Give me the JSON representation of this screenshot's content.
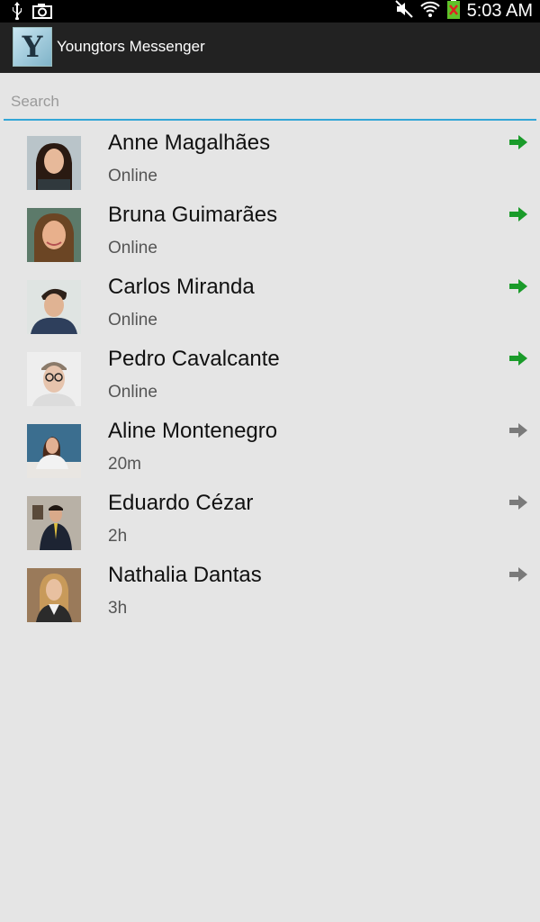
{
  "status_bar": {
    "time": "5:03 AM",
    "icons": [
      "usb-icon",
      "camera-icon",
      "mute-icon",
      "wifi-icon",
      "battery-icon"
    ]
  },
  "app": {
    "logo_letter": "Y",
    "title": "Youngtors Messenger"
  },
  "search": {
    "placeholder": "Search",
    "value": ""
  },
  "colors": {
    "online_arrow": "#1a9b2a",
    "offline_arrow": "#7a7a7a",
    "search_underline": "#33a6d6",
    "actionbar": "#222222",
    "background": "#e5e5e5"
  },
  "contacts": [
    {
      "name": "Anne Magalhães",
      "status": "Online",
      "online": true
    },
    {
      "name": "Bruna Guimarães",
      "status": "Online",
      "online": true
    },
    {
      "name": "Carlos Miranda",
      "status": "Online",
      "online": true
    },
    {
      "name": "Pedro Cavalcante",
      "status": "Online",
      "online": true
    },
    {
      "name": "Aline Montenegro",
      "status": "20m",
      "online": false
    },
    {
      "name": "Eduardo Cézar",
      "status": "2h",
      "online": false
    },
    {
      "name": "Nathalia Dantas",
      "status": "3h",
      "online": false
    }
  ]
}
